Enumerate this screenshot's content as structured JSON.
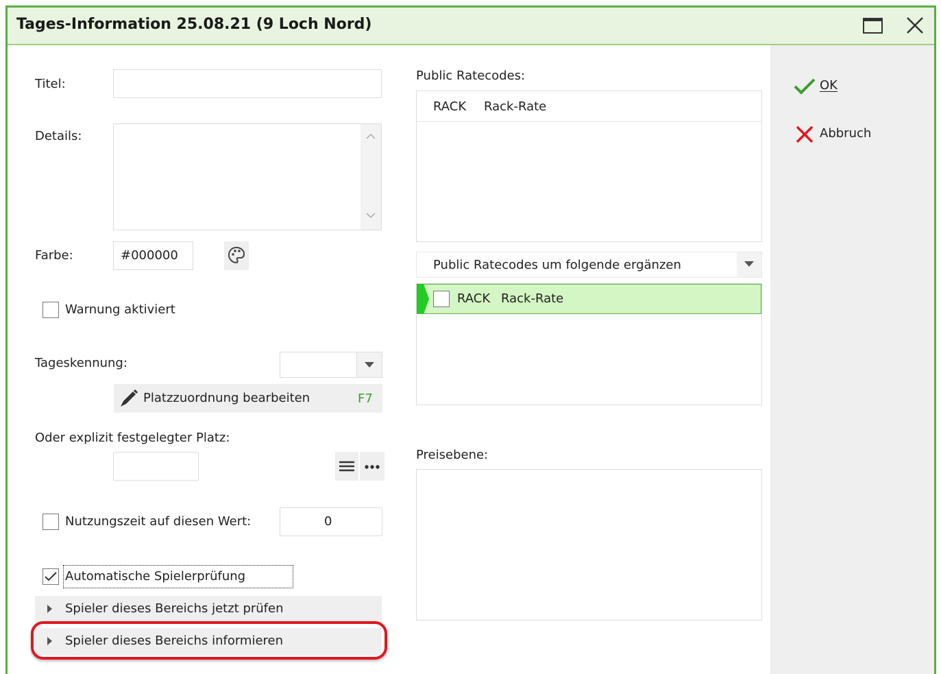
{
  "window": {
    "title": "Tages-Information 25.08.21 (9 Loch Nord)"
  },
  "form": {
    "titel_label": "Titel:",
    "titel_value": "",
    "details_label": "Details:",
    "details_value": "",
    "farbe_label": "Farbe:",
    "farbe_value": "#000000",
    "warnung_label": "Warnung aktiviert",
    "warnung_checked": false,
    "tageskennung_label": "Tageskennung:",
    "tageskennung_value": "",
    "platzzuordnung_label": "Platzzuordnung bearbeiten",
    "platzzuordnung_shortcut": "F7",
    "platz_label": "Oder explizit festgelegter Platz:",
    "platz_value": "",
    "nutzungszeit_label": "Nutzungszeit auf diesen Wert:",
    "nutzungszeit_value": "0",
    "nutzungszeit_checked": false,
    "auto_pruefung_label": "Automatische Spielerprüfung",
    "auto_pruefung_checked": true,
    "pruefen_label": "Spieler dieses Bereichs jetzt prüfen",
    "informieren_label": "Spieler dieses Bereichs informieren"
  },
  "ratecodes": {
    "label": "Public Ratecodes:",
    "items": [
      {
        "code": "RACK",
        "name": "Rack-Rate"
      }
    ],
    "combo_value": "Public Ratecodes um folgende ergänzen",
    "extra_items": [
      {
        "code": "RACK",
        "name": "Rack-Rate",
        "checked": false
      }
    ]
  },
  "preisebene": {
    "label": "Preisebene:"
  },
  "actions": {
    "ok_label": "OK",
    "abbruch_label": "Abbruch"
  },
  "colors": {
    "accent_green": "#5aac44",
    "highlight_green": "#d4f5c4",
    "annotation_red": "#e0181e"
  }
}
